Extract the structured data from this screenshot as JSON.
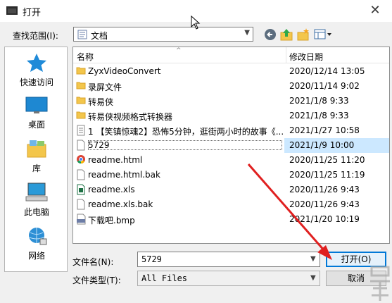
{
  "window": {
    "title": "打开",
    "close_symbol": "✕"
  },
  "lookin": {
    "label": "查找范围(I):",
    "value": "文档"
  },
  "toolbar": {
    "back_icon": "back-arrow-icon",
    "up_icon": "up-folder-icon",
    "newfolder_icon": "new-folder-icon",
    "view_icon": "view-menu-icon"
  },
  "places": [
    {
      "label": "快速访问",
      "icon": "star-icon"
    },
    {
      "label": "桌面",
      "icon": "desktop-icon"
    },
    {
      "label": "库",
      "icon": "library-icon"
    },
    {
      "label": "此电脑",
      "icon": "computer-icon"
    },
    {
      "label": "网络",
      "icon": "network-icon"
    }
  ],
  "filelist": {
    "col_name": "名称",
    "col_date": "修改日期",
    "rows": [
      {
        "name": "ZyxVideoConvert",
        "date": "2020/12/14 13:05",
        "icon": "folder-icon"
      },
      {
        "name": "录屏文件",
        "date": "2020/11/14 9:02",
        "icon": "folder-icon"
      },
      {
        "name": "转易侠",
        "date": "2021/1/8 9:33",
        "icon": "folder-icon"
      },
      {
        "name": "转易侠视频格式转换器",
        "date": "2021/1/8 9:33",
        "icon": "folder-icon"
      },
      {
        "name": "1 【笑镇惊魂2】恐怖5分钟，逛街两小时的故事《...",
        "date": "2021/1/27 10:58",
        "icon": "text-file-icon"
      },
      {
        "name": "5729",
        "date": "2021/1/9 10:00",
        "icon": "blank-file-icon"
      },
      {
        "name": "readme.html",
        "date": "2020/11/25 11:20",
        "icon": "chrome-icon"
      },
      {
        "name": "readme.html.bak",
        "date": "2020/11/25 11:19",
        "icon": "blank-file-icon"
      },
      {
        "name": "readme.xls",
        "date": "2020/11/26 9:43",
        "icon": "excel-icon"
      },
      {
        "name": "readme.xls.bak",
        "date": "2020/11/26 9:43",
        "icon": "blank-file-icon"
      },
      {
        "name": "下载吧.bmp",
        "date": "2021/1/20 10:19",
        "icon": "bmp-icon"
      }
    ]
  },
  "filename": {
    "label": "文件名(N):",
    "value": "5729"
  },
  "filetype": {
    "label": "文件类型(T):",
    "value": "All Files"
  },
  "buttons": {
    "open": "打开(O)",
    "cancel": "取消"
  },
  "colors": {
    "accent": "#0078d7",
    "annotation": "#e02020",
    "selection": "#cce8ff"
  }
}
